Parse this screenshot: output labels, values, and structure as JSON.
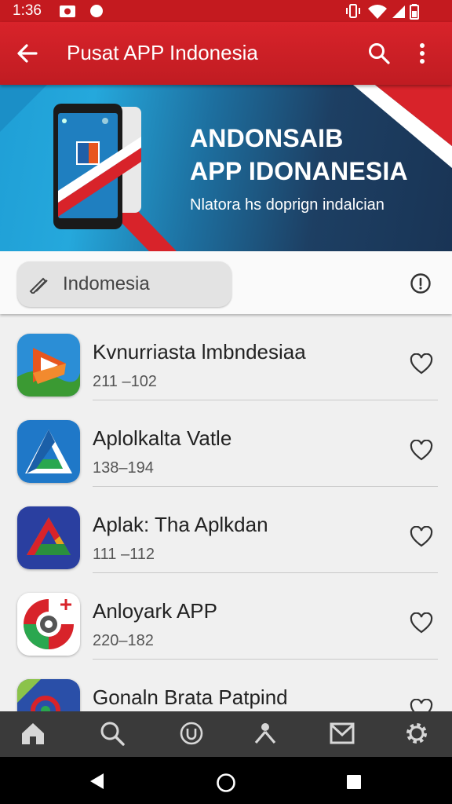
{
  "status_bar": {
    "time": "1:36",
    "icons": [
      "camera-icon",
      "dot-icon",
      "vibrate-icon",
      "wifi-icon",
      "signal-icon",
      "battery-icon"
    ]
  },
  "app_bar": {
    "title": "Pusat APP Indonesia",
    "icons": [
      "back-arrow-icon",
      "search-icon",
      "more-vert-icon"
    ]
  },
  "banner": {
    "heading_line1": "ANDONSAIB",
    "heading_line2": "APP IDONANESIA",
    "subtitle": "Nlatora hs doprign indalcian"
  },
  "filter": {
    "chip_label": "Indomesia",
    "chip_icon": "edit-icon",
    "info_icon": "info-icon"
  },
  "apps": [
    {
      "name": "Kvnurriasta lmbndesiaa",
      "count": "211 –102"
    },
    {
      "name": "Aplolkalta Vatle",
      "count": "138–194"
    },
    {
      "name": "Aplak: Tha Aplkdan",
      "count": "111 –112"
    },
    {
      "name": "Anloyark APP",
      "count": "220–182"
    },
    {
      "name": "Gonaln Brata Patpind",
      "count": ""
    }
  ],
  "bottom_nav": [
    "home-icon",
    "search-icon",
    "circle-u-icon",
    "tools-icon",
    "inbox-icon",
    "settings-gear-icon"
  ],
  "system_nav": [
    "back-triangle-icon",
    "home-circle-icon",
    "recents-square-icon"
  ],
  "colors": {
    "accent": "#d8232a",
    "banner_dark": "#193455",
    "banner_light": "#25a8dc",
    "nav_bg": "#3a3a3a"
  }
}
